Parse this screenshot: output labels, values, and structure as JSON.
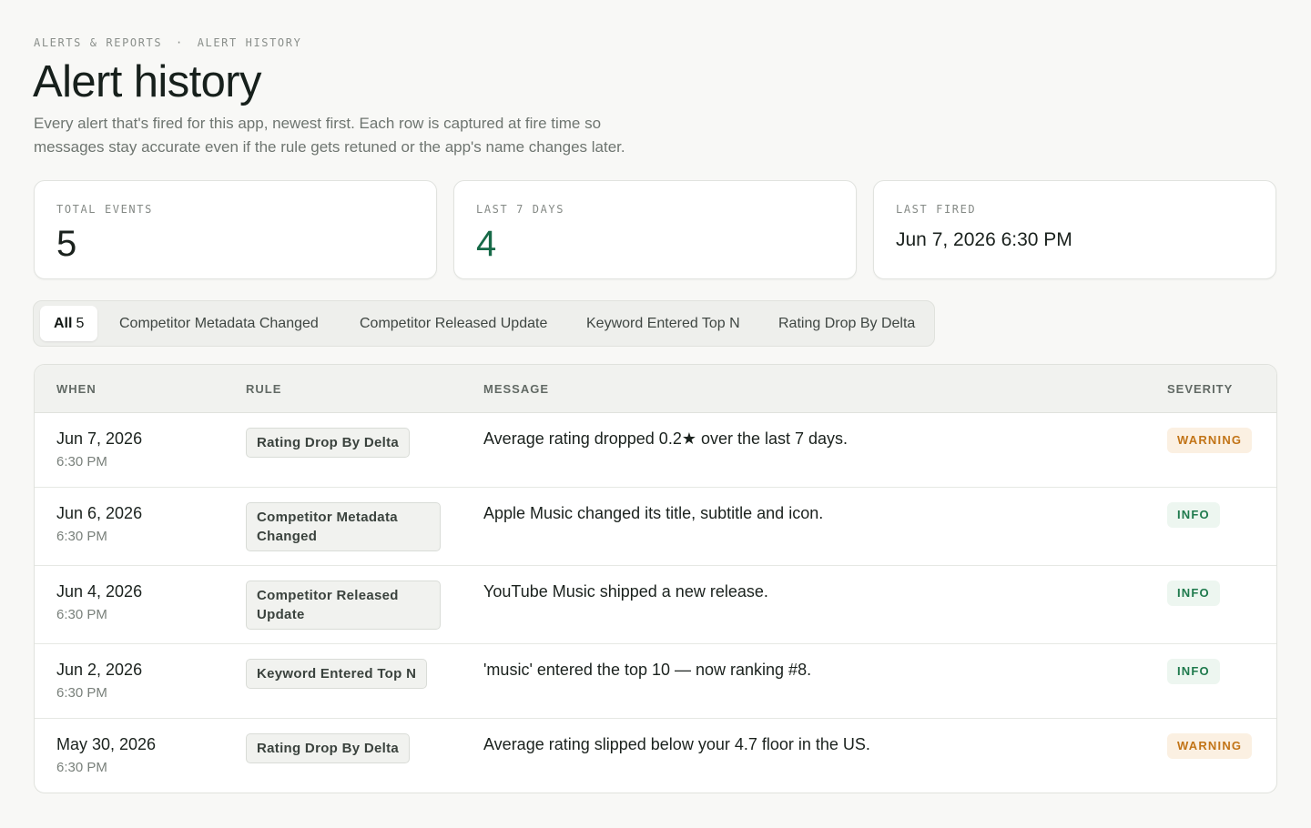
{
  "breadcrumb": {
    "parent": "ALERTS & REPORTS",
    "separator": "·",
    "current": "ALERT HISTORY"
  },
  "header": {
    "title": "Alert history",
    "subtitle": "Every alert that's fired for this app, newest first. Each row is captured at fire time so messages stay accurate even if the rule gets retuned or the app's name changes later."
  },
  "stats": {
    "total_events": {
      "label": "TOTAL EVENTS",
      "value": "5"
    },
    "last_7_days": {
      "label": "LAST 7 DAYS",
      "value": "4"
    },
    "last_fired": {
      "label": "LAST FIRED",
      "value": "Jun 7, 2026 6:30 PM"
    }
  },
  "filters": [
    {
      "label": "All",
      "count": "5",
      "active": true
    },
    {
      "label": "Competitor Metadata Changed"
    },
    {
      "label": "Competitor Released Update"
    },
    {
      "label": "Keyword Entered Top N"
    },
    {
      "label": "Rating Drop By Delta"
    }
  ],
  "table": {
    "columns": {
      "when": "WHEN",
      "rule": "RULE",
      "message": "MESSAGE",
      "severity": "SEVERITY"
    },
    "rows": [
      {
        "date": "Jun 7, 2026",
        "time": "6:30 PM",
        "rule": "Rating Drop By Delta",
        "message": "Average rating dropped 0.2★ over the last 7 days.",
        "severity": "WARNING"
      },
      {
        "date": "Jun 6, 2026",
        "time": "6:30 PM",
        "rule": "Competitor Metadata Changed",
        "message": "Apple Music changed its title, subtitle and icon.",
        "severity": "INFO"
      },
      {
        "date": "Jun 4, 2026",
        "time": "6:30 PM",
        "rule": "Competitor Released Update",
        "message": "YouTube Music shipped a new release.",
        "severity": "INFO"
      },
      {
        "date": "Jun 2, 2026",
        "time": "6:30 PM",
        "rule": "Keyword Entered Top N",
        "message": "'music' entered the top 10 — now ranking #8.",
        "severity": "INFO"
      },
      {
        "date": "May 30, 2026",
        "time": "6:30 PM",
        "rule": "Rating Drop By Delta",
        "message": "Average rating slipped below your 4.7 floor in the US.",
        "severity": "WARNING"
      }
    ]
  },
  "colors": {
    "accent_green": "#176a48",
    "warning_text": "#c27417",
    "warning_bg": "#fbf0e2",
    "info_text": "#1f7a4d",
    "info_bg": "#edf6f0"
  }
}
